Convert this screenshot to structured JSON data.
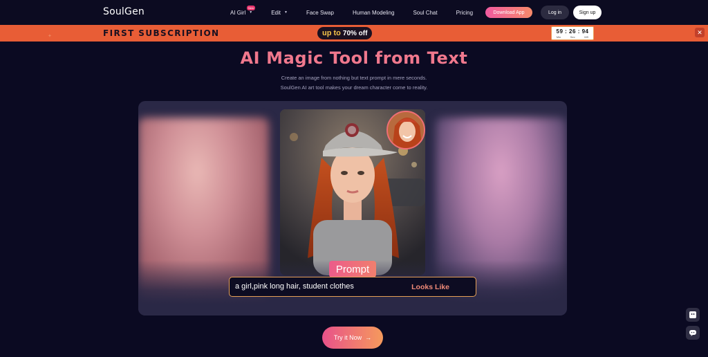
{
  "nav": {
    "logo": "SoulGen",
    "items": [
      {
        "label": "AI Girl",
        "badge": "New",
        "caret": "▼"
      },
      {
        "label": "Edit",
        "caret": "▼"
      },
      {
        "label": "Face Swap"
      },
      {
        "label": "Human Modeling"
      },
      {
        "label": "Soul Chat"
      },
      {
        "label": "Pricing"
      }
    ],
    "download": "Download App",
    "login": "Log in",
    "signup": "Sign up"
  },
  "promo": {
    "title": "FIRST SUBSCRIPTION",
    "pill_a": "up to",
    "pill_b": "70% off",
    "timer": {
      "min": "59",
      "sec": "26",
      "ms": "94",
      "sep": ":",
      "units": [
        "Min",
        "Sec",
        "MS"
      ]
    },
    "close": "✕"
  },
  "hero": {
    "title": "AI Magic Tool from Text",
    "sub1": "Create an image from nothing but text prompt in mere seconds.",
    "sub2": "SoulGen AI art tool makes your dream character come to reality."
  },
  "prompt": {
    "tag": "Prompt",
    "text": "a girl,pink long hair, student clothes",
    "looks_like": "Looks Like"
  },
  "cta": {
    "label": "Try it Now",
    "arrow": "→"
  },
  "colors": {
    "accent": "#f0788d",
    "promo": "#e85d36",
    "background": "#0b0a22"
  }
}
